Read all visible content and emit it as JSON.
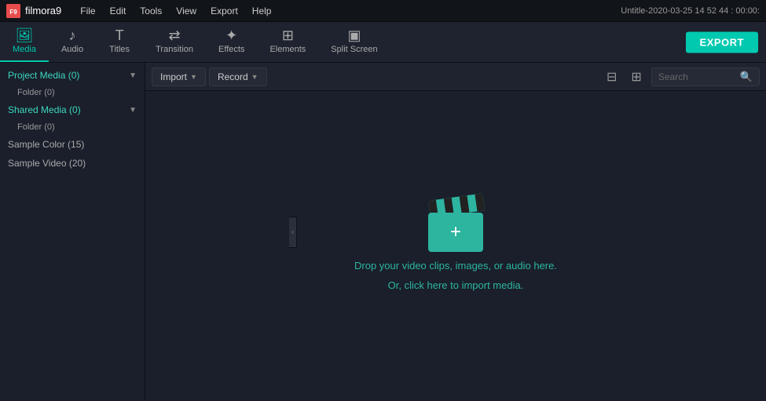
{
  "titlebar": {
    "logo": "F9",
    "appname": "filmora9",
    "menu": [
      "File",
      "Edit",
      "Tools",
      "View",
      "Export",
      "Help"
    ],
    "title": "Untitle-2020-03-25 14 52 44 : 00:00:"
  },
  "toolbar": {
    "export_label": "EXPORT",
    "buttons": [
      {
        "id": "media",
        "label": "Media",
        "icon": "🖼",
        "active": true
      },
      {
        "id": "audio",
        "label": "Audio",
        "icon": "♪"
      },
      {
        "id": "titles",
        "label": "Titles",
        "icon": "T"
      },
      {
        "id": "transition",
        "label": "Transition",
        "icon": "⇄"
      },
      {
        "id": "effects",
        "label": "Effects",
        "icon": "✦"
      },
      {
        "id": "elements",
        "label": "Elements",
        "icon": "⊞"
      },
      {
        "id": "splitscreen",
        "label": "Split Screen",
        "icon": "▣"
      }
    ]
  },
  "sidebar": {
    "groups": [
      {
        "label": "Project Media (0)",
        "expanded": true,
        "children": [
          "Folder (0)"
        ]
      },
      {
        "label": "Shared Media (0)",
        "expanded": true,
        "children": [
          "Folder (0)"
        ]
      }
    ],
    "items": [
      "Sample Color (15)",
      "Sample Video (20)"
    ]
  },
  "content_toolbar": {
    "import_label": "Import",
    "record_label": "Record",
    "search_placeholder": "Search"
  },
  "dropzone": {
    "line1": "Drop your video clips, images, or audio here.",
    "line2": "Or, click here to import media."
  }
}
